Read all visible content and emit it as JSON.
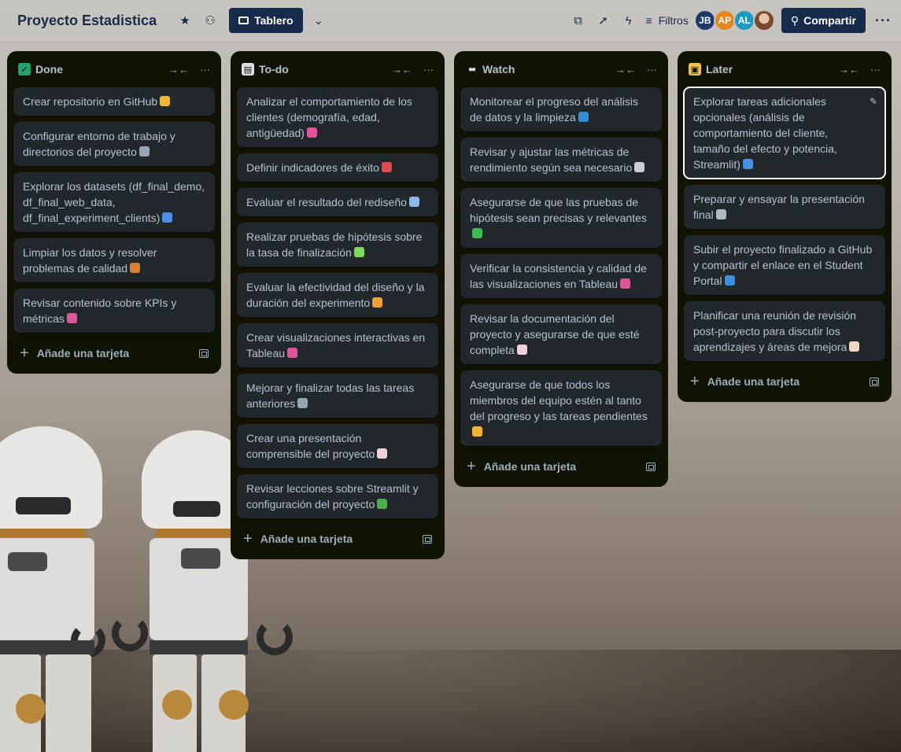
{
  "header": {
    "board_title": "Proyecto Estadistica",
    "view_label": "Tablero",
    "filters_label": "Filtros",
    "share_label": "Compartir",
    "more_label": "···",
    "icons": [
      "star-icon",
      "workspace-visibility-icon",
      "board-view-icon",
      "chevron-down-icon",
      "power-ups-icon",
      "automation-icon",
      "lightning-icon",
      "filter-icon",
      "add-member-icon",
      "more-icon"
    ]
  },
  "members": [
    {
      "initials": "JB",
      "color": "#1d3a6e"
    },
    {
      "initials": "AP",
      "color": "#e6871c"
    },
    {
      "initials": "AL",
      "color": "#1a9bc6"
    },
    {
      "initials": "",
      "color": "#c9a58a"
    }
  ],
  "list_actions": {
    "collapse": "→←",
    "more": "···"
  },
  "add_card_label": "Añade una tarjeta",
  "lists": [
    {
      "title": "Done",
      "icon": "check-box-icon",
      "icon_color": "#22a06b",
      "cards": [
        {
          "text": "Crear repositorio en GitHub",
          "emoji": "folder-emoji",
          "emoji_color": "#f5b82e"
        },
        {
          "text": "Configurar entorno de trabajo y directorios del proyecto",
          "emoji": "tools-emoji",
          "emoji_color": "#9aa5b1"
        },
        {
          "text": "Explorar los datasets (df_final_demo, df_final_web_data, df_final_experiment_clients)",
          "emoji": "magnifier-emoji",
          "emoji_color": "#4a90e2"
        },
        {
          "text": "Limpiar los datos y resolver problemas de calidad",
          "emoji": "broom-emoji",
          "emoji_color": "#d9822b"
        },
        {
          "text": "Revisar contenido sobre KPIs y métricas",
          "emoji": "bar-chart-emoji",
          "emoji_color": "#e0559a"
        }
      ]
    },
    {
      "title": "To-do",
      "icon": "clipboard-icon",
      "icon_color": "#dcdfe4",
      "cards": [
        {
          "text": "Analizar el comportamiento de los clientes (demografía, edad, antigüedad)",
          "emoji": "bar-chart-emoji",
          "emoji_color": "#e0559a"
        },
        {
          "text": "Definir indicadores de éxito",
          "emoji": "target-emoji",
          "emoji_color": "#e5484d"
        },
        {
          "text": "Evaluar el resultado del rediseño",
          "emoji": "chart-up-emoji",
          "emoji_color": "#8fb8e8"
        },
        {
          "text": "Realizar pruebas de hipótesis sobre la tasa de finalización",
          "emoji": "test-tube-emoji",
          "emoji_color": "#7ed957"
        },
        {
          "text": "Evaluar la efectividad del diseño y la duración del experimento",
          "emoji": "palette-and-hourglass-emoji",
          "emoji_color": "#f0a030"
        },
        {
          "text": "Crear visualizaciones interactivas en Tableau",
          "emoji": "bar-chart-emoji",
          "emoji_color": "#e0559a"
        },
        {
          "text": "Mejorar y finalizar todas las tareas anteriores",
          "emoji": "tools-emoji",
          "emoji_color": "#9aa5b1"
        },
        {
          "text": "Crear una presentación comprensible del proyecto",
          "emoji": "document-emoji",
          "emoji_color": "#f0d0dc"
        },
        {
          "text": "Revisar lecciones sobre Streamlit y configuración del proyecto",
          "emoji": "books-emoji",
          "emoji_color": "#4caf50"
        }
      ]
    },
    {
      "title": "Watch",
      "icon": "eyes-icon",
      "icon_color": "#ffffff",
      "cards": [
        {
          "text": "Monitorear el progreso del análisis de datos y la limpieza",
          "emoji": "refresh-emoji",
          "emoji_color": "#2d8fd5"
        },
        {
          "text": "Revisar y ajustar las métricas de rendimiento según sea necesario",
          "emoji": "ruler-emoji",
          "emoji_color": "#c9ced6"
        },
        {
          "text": "Asegurarse de que las pruebas de hipótesis sean precisas y relevantes",
          "emoji": "check-emoji",
          "emoji_color": "#3fb950"
        },
        {
          "text": "Verificar la consistencia y calidad de las visualizaciones en Tableau",
          "emoji": "bar-chart-emoji",
          "emoji_color": "#e0559a"
        },
        {
          "text": "Revisar la documentación del proyecto y asegurarse de que esté completa",
          "emoji": "document-emoji",
          "emoji_color": "#f0d0dc"
        },
        {
          "text": "Asegurarse de que todos los miembros del equipo estén al tanto del progreso y las tareas pendientes",
          "emoji": "handshake-emoji",
          "emoji_color": "#f2b233"
        }
      ]
    },
    {
      "title": "Later",
      "icon": "card-file-box-icon",
      "icon_color": "#f0c14b",
      "cards": [
        {
          "text": "Explorar tareas adicionales opcionales (análisis de comportamiento del cliente, tamaño del efecto y potencia, Streamlit)",
          "emoji": "magnifier-emoji",
          "emoji_color": "#4a90e2",
          "focused": true
        },
        {
          "text": "Preparar y ensayar la presentación final",
          "emoji": "hammer-emoji",
          "emoji_color": "#b0b8c4"
        },
        {
          "text": "Subir el proyecto finalizado a GitHub y compartir el enlace en el Student Portal",
          "emoji": "globe-emoji",
          "emoji_color": "#3b8fe0"
        },
        {
          "text": "Planificar una reunión de revisión post-proyecto para discutir los aprendizajes y áreas de mejora",
          "emoji": "memo-emoji",
          "emoji_color": "#f3d7c4"
        }
      ]
    }
  ]
}
